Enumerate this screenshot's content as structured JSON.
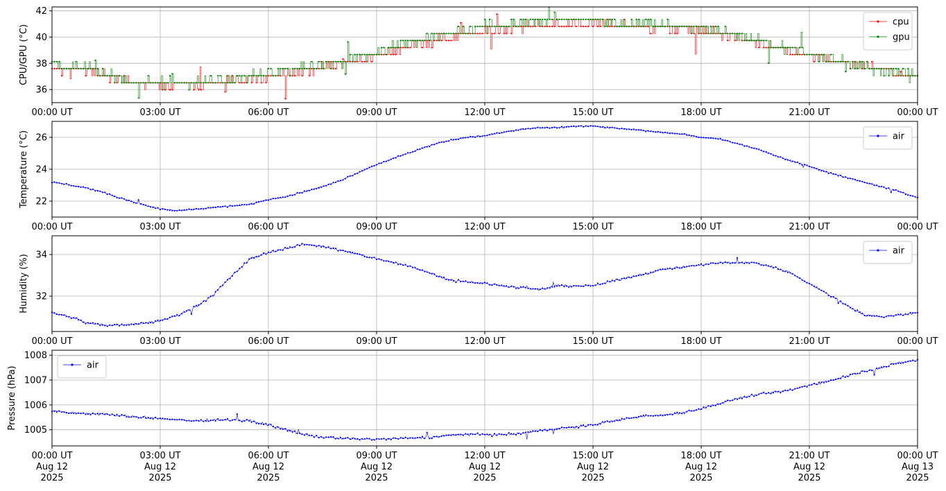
{
  "figure": {
    "background": "#ffffff",
    "grid": true,
    "grid_color": "#b0b0b0"
  },
  "chart_data": [
    {
      "type": "line",
      "name": "cpu-gpu-panel",
      "xlabel": "",
      "ylabel": "CPU/GPU (°C)",
      "xlim": [
        "00:00",
        "24:00"
      ],
      "ylim": [
        35.0,
        42.3
      ],
      "yticks": [
        36,
        38,
        40,
        42
      ],
      "xtick_labels": [
        "00:00 UT",
        "03:00 UT",
        "06:00 UT",
        "09:00 UT",
        "12:00 UT",
        "15:00 UT",
        "18:00 UT",
        "21:00 UT",
        "00:00 UT"
      ],
      "legend": "top-right",
      "step_values": true,
      "series": [
        {
          "name": "cpu",
          "color": "#ff0000",
          "x_hours": [
            0,
            1,
            2,
            3,
            4,
            5,
            6,
            7,
            8,
            9,
            10,
            11,
            12,
            13,
            14,
            15,
            16,
            17,
            18,
            19,
            20,
            21,
            22,
            23,
            24
          ],
          "values": [
            37.5,
            37.5,
            36.6,
            36.4,
            36.4,
            36.6,
            37.0,
            37.4,
            38.0,
            38.5,
            39.4,
            40.0,
            40.5,
            40.8,
            41.0,
            41.0,
            40.8,
            40.7,
            40.5,
            40.0,
            39.2,
            38.5,
            38.0,
            37.5,
            36.8
          ],
          "noise": 0.45
        },
        {
          "name": "gpu",
          "color": "#008000",
          "x_hours": [
            0,
            1,
            2,
            3,
            4,
            5,
            6,
            7,
            8,
            9,
            10,
            11,
            12,
            13,
            14,
            15,
            16,
            17,
            18,
            19,
            20,
            21,
            22,
            23,
            24
          ],
          "values": [
            37.9,
            37.6,
            36.8,
            36.5,
            36.5,
            36.8,
            37.2,
            37.7,
            38.2,
            38.8,
            39.7,
            40.3,
            40.8,
            41.1,
            41.3,
            41.3,
            41.0,
            40.9,
            40.7,
            40.2,
            39.4,
            38.7,
            38.1,
            37.5,
            37.0
          ],
          "noise": 0.5
        }
      ]
    },
    {
      "type": "line",
      "name": "temperature-panel",
      "xlabel": "",
      "ylabel": "Temperature (°C)",
      "xlim": [
        "00:00",
        "24:00"
      ],
      "ylim": [
        21.0,
        27.0
      ],
      "yticks": [
        22,
        24,
        26
      ],
      "xtick_labels": [
        "00:00 UT",
        "03:00 UT",
        "06:00 UT",
        "09:00 UT",
        "12:00 UT",
        "15:00 UT",
        "18:00 UT",
        "21:00 UT",
        "00:00 UT"
      ],
      "legend": "top-right",
      "series": [
        {
          "name": "air",
          "color": "#0000ff",
          "x_hours": [
            0,
            0.5,
            1,
            1.5,
            2,
            2.5,
            3,
            3.5,
            4,
            4.5,
            5,
            5.5,
            6,
            6.5,
            7,
            7.5,
            8,
            8.5,
            9,
            9.5,
            10,
            10.5,
            11,
            11.5,
            12,
            12.5,
            13,
            13.5,
            14,
            14.5,
            15,
            15.5,
            16,
            16.5,
            17,
            17.5,
            18,
            18.5,
            19,
            19.5,
            20,
            20.5,
            21,
            21.5,
            22,
            22.5,
            23,
            23.5,
            24
          ],
          "values": [
            23.2,
            23.0,
            22.8,
            22.5,
            22.1,
            21.8,
            21.5,
            21.4,
            21.5,
            21.6,
            21.7,
            21.8,
            22.1,
            22.3,
            22.6,
            22.9,
            23.3,
            23.8,
            24.3,
            24.7,
            25.1,
            25.5,
            25.8,
            26.0,
            26.1,
            26.3,
            26.5,
            26.6,
            26.6,
            26.7,
            26.7,
            26.6,
            26.5,
            26.4,
            26.3,
            26.2,
            26.0,
            25.9,
            25.6,
            25.3,
            24.9,
            24.5,
            24.2,
            23.8,
            23.5,
            23.2,
            22.9,
            22.6,
            22.2
          ],
          "noise": 0.06
        }
      ]
    },
    {
      "type": "line",
      "name": "humidity-panel",
      "xlabel": "",
      "ylabel": "Humidity (%)",
      "xlim": [
        "00:00",
        "24:00"
      ],
      "ylim": [
        30.3,
        34.9
      ],
      "yticks": [
        32,
        34
      ],
      "xtick_labels": [
        "00:00 UT",
        "03:00 UT",
        "06:00 UT",
        "09:00 UT",
        "12:00 UT",
        "15:00 UT",
        "18:00 UT",
        "21:00 UT",
        "00:00 UT"
      ],
      "legend": "top-right",
      "series": [
        {
          "name": "air",
          "color": "#0000ff",
          "x_hours": [
            0,
            0.5,
            1,
            1.5,
            2,
            2.5,
            3,
            3.5,
            4,
            4.5,
            5,
            5.5,
            6,
            6.5,
            7,
            7.5,
            8,
            8.5,
            9,
            9.5,
            10,
            10.5,
            11,
            11.5,
            12,
            12.5,
            13,
            13.5,
            14,
            14.5,
            15,
            15.5,
            16,
            16.5,
            17,
            17.5,
            18,
            18.5,
            19,
            19.5,
            20,
            20.5,
            21,
            21.5,
            22,
            22.5,
            23,
            23.5,
            24
          ],
          "values": [
            31.2,
            31.0,
            30.7,
            30.6,
            30.6,
            30.7,
            30.8,
            31.1,
            31.5,
            32.1,
            33.0,
            33.8,
            34.1,
            34.3,
            34.5,
            34.4,
            34.2,
            34.0,
            33.8,
            33.6,
            33.4,
            33.1,
            32.8,
            32.7,
            32.6,
            32.5,
            32.4,
            32.3,
            32.5,
            32.5,
            32.5,
            32.7,
            32.9,
            33.1,
            33.3,
            33.4,
            33.5,
            33.6,
            33.6,
            33.6,
            33.4,
            33.1,
            32.6,
            32.1,
            31.6,
            31.1,
            31.0,
            31.1,
            31.2
          ],
          "noise": 0.08
        }
      ]
    },
    {
      "type": "line",
      "name": "pressure-panel",
      "xlabel": "",
      "ylabel": "Pressure (hPa)",
      "xlim": [
        "00:00",
        "24:00"
      ],
      "ylim": [
        1004.35,
        1008.2
      ],
      "yticks": [
        1005,
        1006,
        1007,
        1008
      ],
      "xtick_labels": [
        "00:00 UT\nAug 12\n2025",
        "03:00 UT\nAug 12\n2025",
        "06:00 UT\nAug 12\n2025",
        "09:00 UT\nAug 12\n2025",
        "12:00 UT\nAug 12\n2025",
        "15:00 UT\nAug 12\n2025",
        "18:00 UT\nAug 12\n2025",
        "21:00 UT\nAug 12\n2025",
        "00:00 UT\nAug 13\n2025"
      ],
      "legend": "top-left",
      "series": [
        {
          "name": "air",
          "color": "#0000ff",
          "x_hours": [
            0,
            0.5,
            1,
            1.5,
            2,
            2.5,
            3,
            3.5,
            4,
            4.5,
            5,
            5.5,
            6,
            6.5,
            7,
            7.5,
            8,
            8.5,
            9,
            9.5,
            10,
            10.5,
            11,
            11.5,
            12,
            12.5,
            13,
            13.5,
            14,
            14.5,
            15,
            15.5,
            16,
            16.5,
            17,
            17.5,
            18,
            18.5,
            19,
            19.5,
            20,
            20.5,
            21,
            21.5,
            22,
            22.5,
            23,
            23.5,
            24
          ],
          "values": [
            1005.75,
            1005.68,
            1005.65,
            1005.62,
            1005.55,
            1005.5,
            1005.45,
            1005.4,
            1005.35,
            1005.4,
            1005.4,
            1005.35,
            1005.2,
            1005.0,
            1004.8,
            1004.7,
            1004.65,
            1004.63,
            1004.62,
            1004.64,
            1004.66,
            1004.7,
            1004.78,
            1004.82,
            1004.8,
            1004.8,
            1004.85,
            1004.95,
            1005.05,
            1005.1,
            1005.2,
            1005.35,
            1005.45,
            1005.55,
            1005.6,
            1005.7,
            1005.85,
            1006.05,
            1006.25,
            1006.4,
            1006.5,
            1006.6,
            1006.8,
            1006.95,
            1007.15,
            1007.35,
            1007.5,
            1007.7,
            1007.8
          ],
          "noise": 0.07
        }
      ]
    }
  ]
}
